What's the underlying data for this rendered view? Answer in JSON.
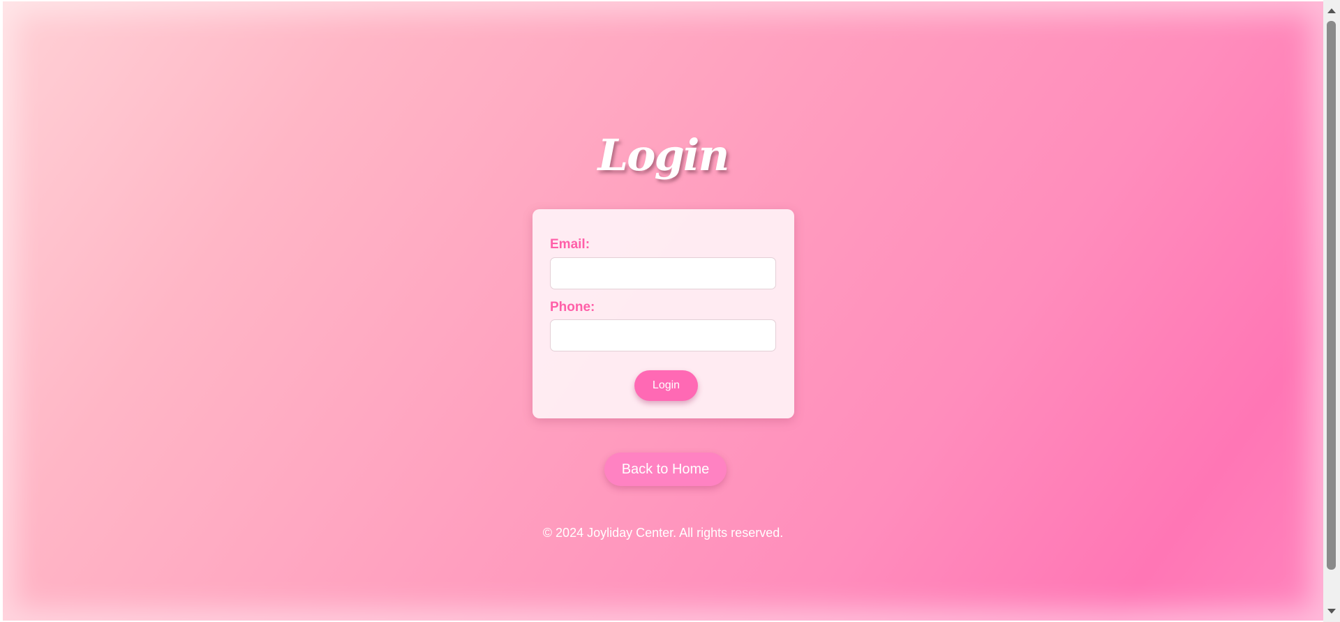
{
  "page": {
    "title": "Login"
  },
  "form": {
    "email_label": "Email:",
    "email_value": "",
    "phone_label": "Phone:",
    "phone_value": "",
    "submit_label": "Login"
  },
  "nav": {
    "home_label": "Back to Home"
  },
  "footer": {
    "text": "© 2024 Joyliday Center. All rights reserved."
  },
  "colors": {
    "accent": "#ff69b4",
    "label": "#ff5fa8",
    "card_background": "#fff0f5"
  }
}
